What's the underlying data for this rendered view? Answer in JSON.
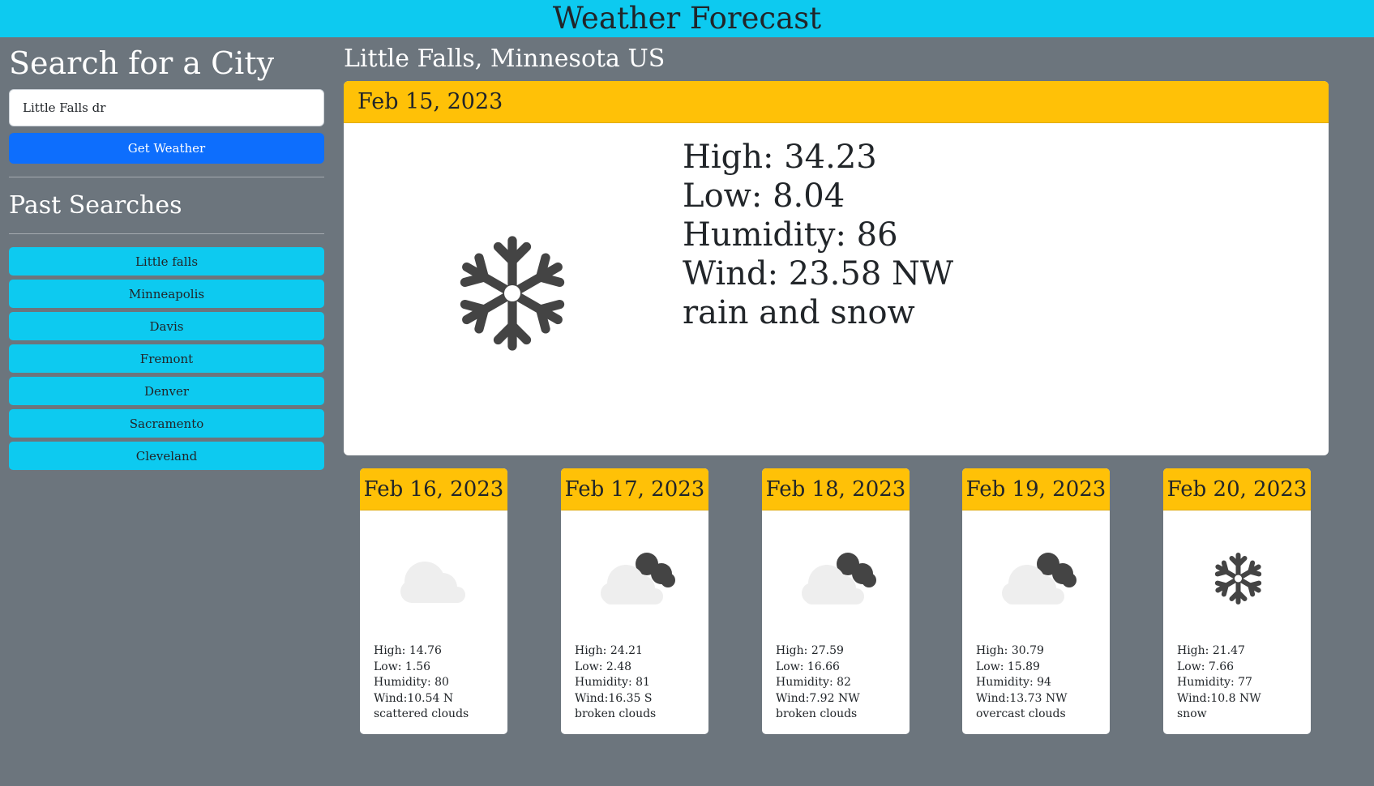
{
  "header": {
    "title": "Weather Forecast"
  },
  "search": {
    "title": "Search for a City",
    "input_value": "Little Falls dr",
    "button_label": "Get Weather"
  },
  "past_searches": {
    "title": "Past Searches",
    "items": [
      "Little falls",
      "Minneapolis",
      "Davis",
      "Fremont",
      "Denver",
      "Sacramento",
      "Cleveland"
    ]
  },
  "current": {
    "city": "Little Falls, Minnesota US",
    "date": "Feb 15, 2023",
    "icon": "snowflake-icon",
    "high": "High: 34.23",
    "low": "Low: 8.04",
    "humidity": "Humidity: 86",
    "wind": "Wind: 23.58 NW",
    "description": "rain and snow"
  },
  "forecast": [
    {
      "date": "Feb 16, 2023",
      "icon": "cloud-icon",
      "high": "High: 14.76",
      "low": "Low: 1.56",
      "humidity": "Humidity: 80",
      "wind": "Wind:10.54 N",
      "description": "scattered clouds"
    },
    {
      "date": "Feb 17, 2023",
      "icon": "broken-clouds-icon",
      "high": "High: 24.21",
      "low": "Low: 2.48",
      "humidity": "Humidity: 81",
      "wind": "Wind:16.35 S",
      "description": "broken clouds"
    },
    {
      "date": "Feb 18, 2023",
      "icon": "broken-clouds-icon",
      "high": "High: 27.59",
      "low": "Low: 16.66",
      "humidity": "Humidity: 82",
      "wind": "Wind:7.92 NW",
      "description": "broken clouds"
    },
    {
      "date": "Feb 19, 2023",
      "icon": "broken-clouds-icon",
      "high": "High: 30.79",
      "low": "Low: 15.89",
      "humidity": "Humidity: 94",
      "wind": "Wind:13.73 NW",
      "description": "overcast clouds"
    },
    {
      "date": "Feb 20, 2023",
      "icon": "snowflake-icon",
      "high": "High: 21.47",
      "low": "Low: 7.66",
      "humidity": "Humidity: 77",
      "wind": "Wind:10.8 NW",
      "description": "snow"
    }
  ],
  "colors": {
    "page_bg": "#6c757d",
    "header_bg": "#0dcaf0",
    "primary_button": "#0d6efd",
    "card_header": "#ffc107"
  }
}
